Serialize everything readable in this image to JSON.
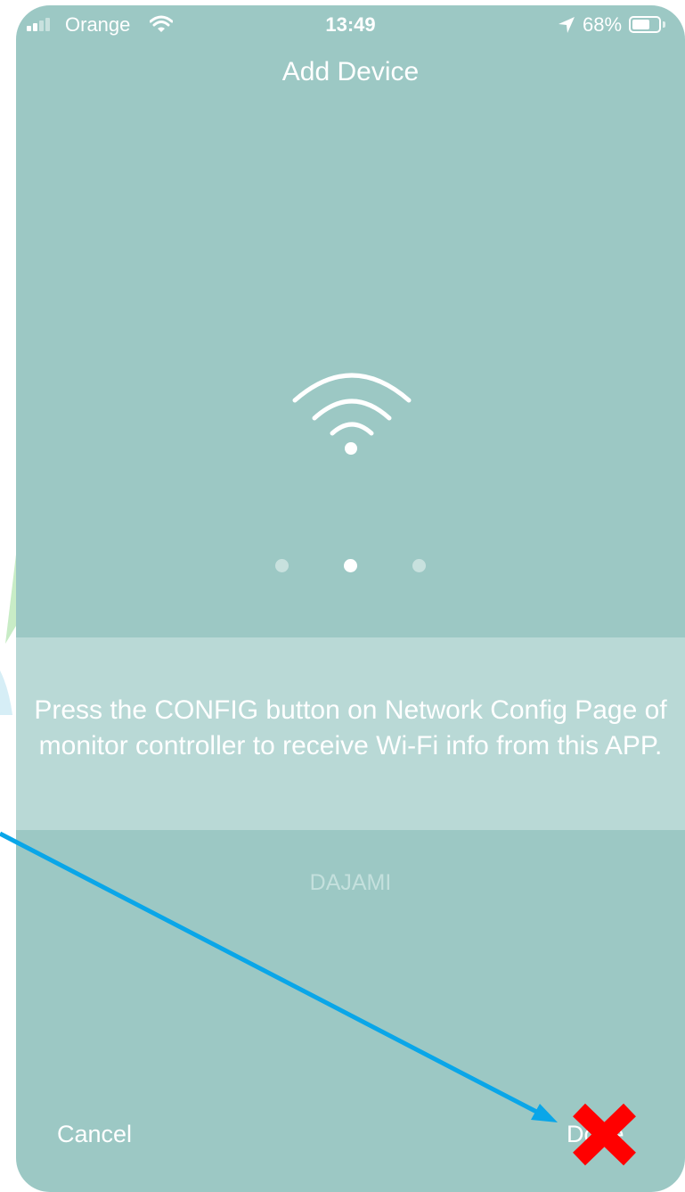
{
  "status_bar": {
    "carrier": "Orange",
    "time": "13:49",
    "battery_percent": "68%",
    "battery_level": 0.68,
    "signal_bars_filled": 2,
    "signal_bars_total": 4,
    "icons": [
      "wifi-icon",
      "location-arrow-icon",
      "battery-icon"
    ]
  },
  "header": {
    "title": "Add Device"
  },
  "hero": {
    "icon": "wifi-icon"
  },
  "pager": {
    "count": 3,
    "active_index": 1
  },
  "instruction": {
    "text": "Press the CONFIG button on Network Config Page of monitor controller to receive Wi-Fi info from this APP."
  },
  "network": {
    "ssid": "DAJAMI"
  },
  "footer": {
    "cancel_label": "Cancel",
    "done_label": "Done"
  },
  "annotations": {
    "arrow_color": "#0aa6e8",
    "cross_color": "#ff0000",
    "arrow_icon": "arrow-icon",
    "cross_icon": "red-cross-icon"
  },
  "colors": {
    "background": "#9cc8c4",
    "instruction_band": "#b9d9d6",
    "text": "#ffffff"
  }
}
